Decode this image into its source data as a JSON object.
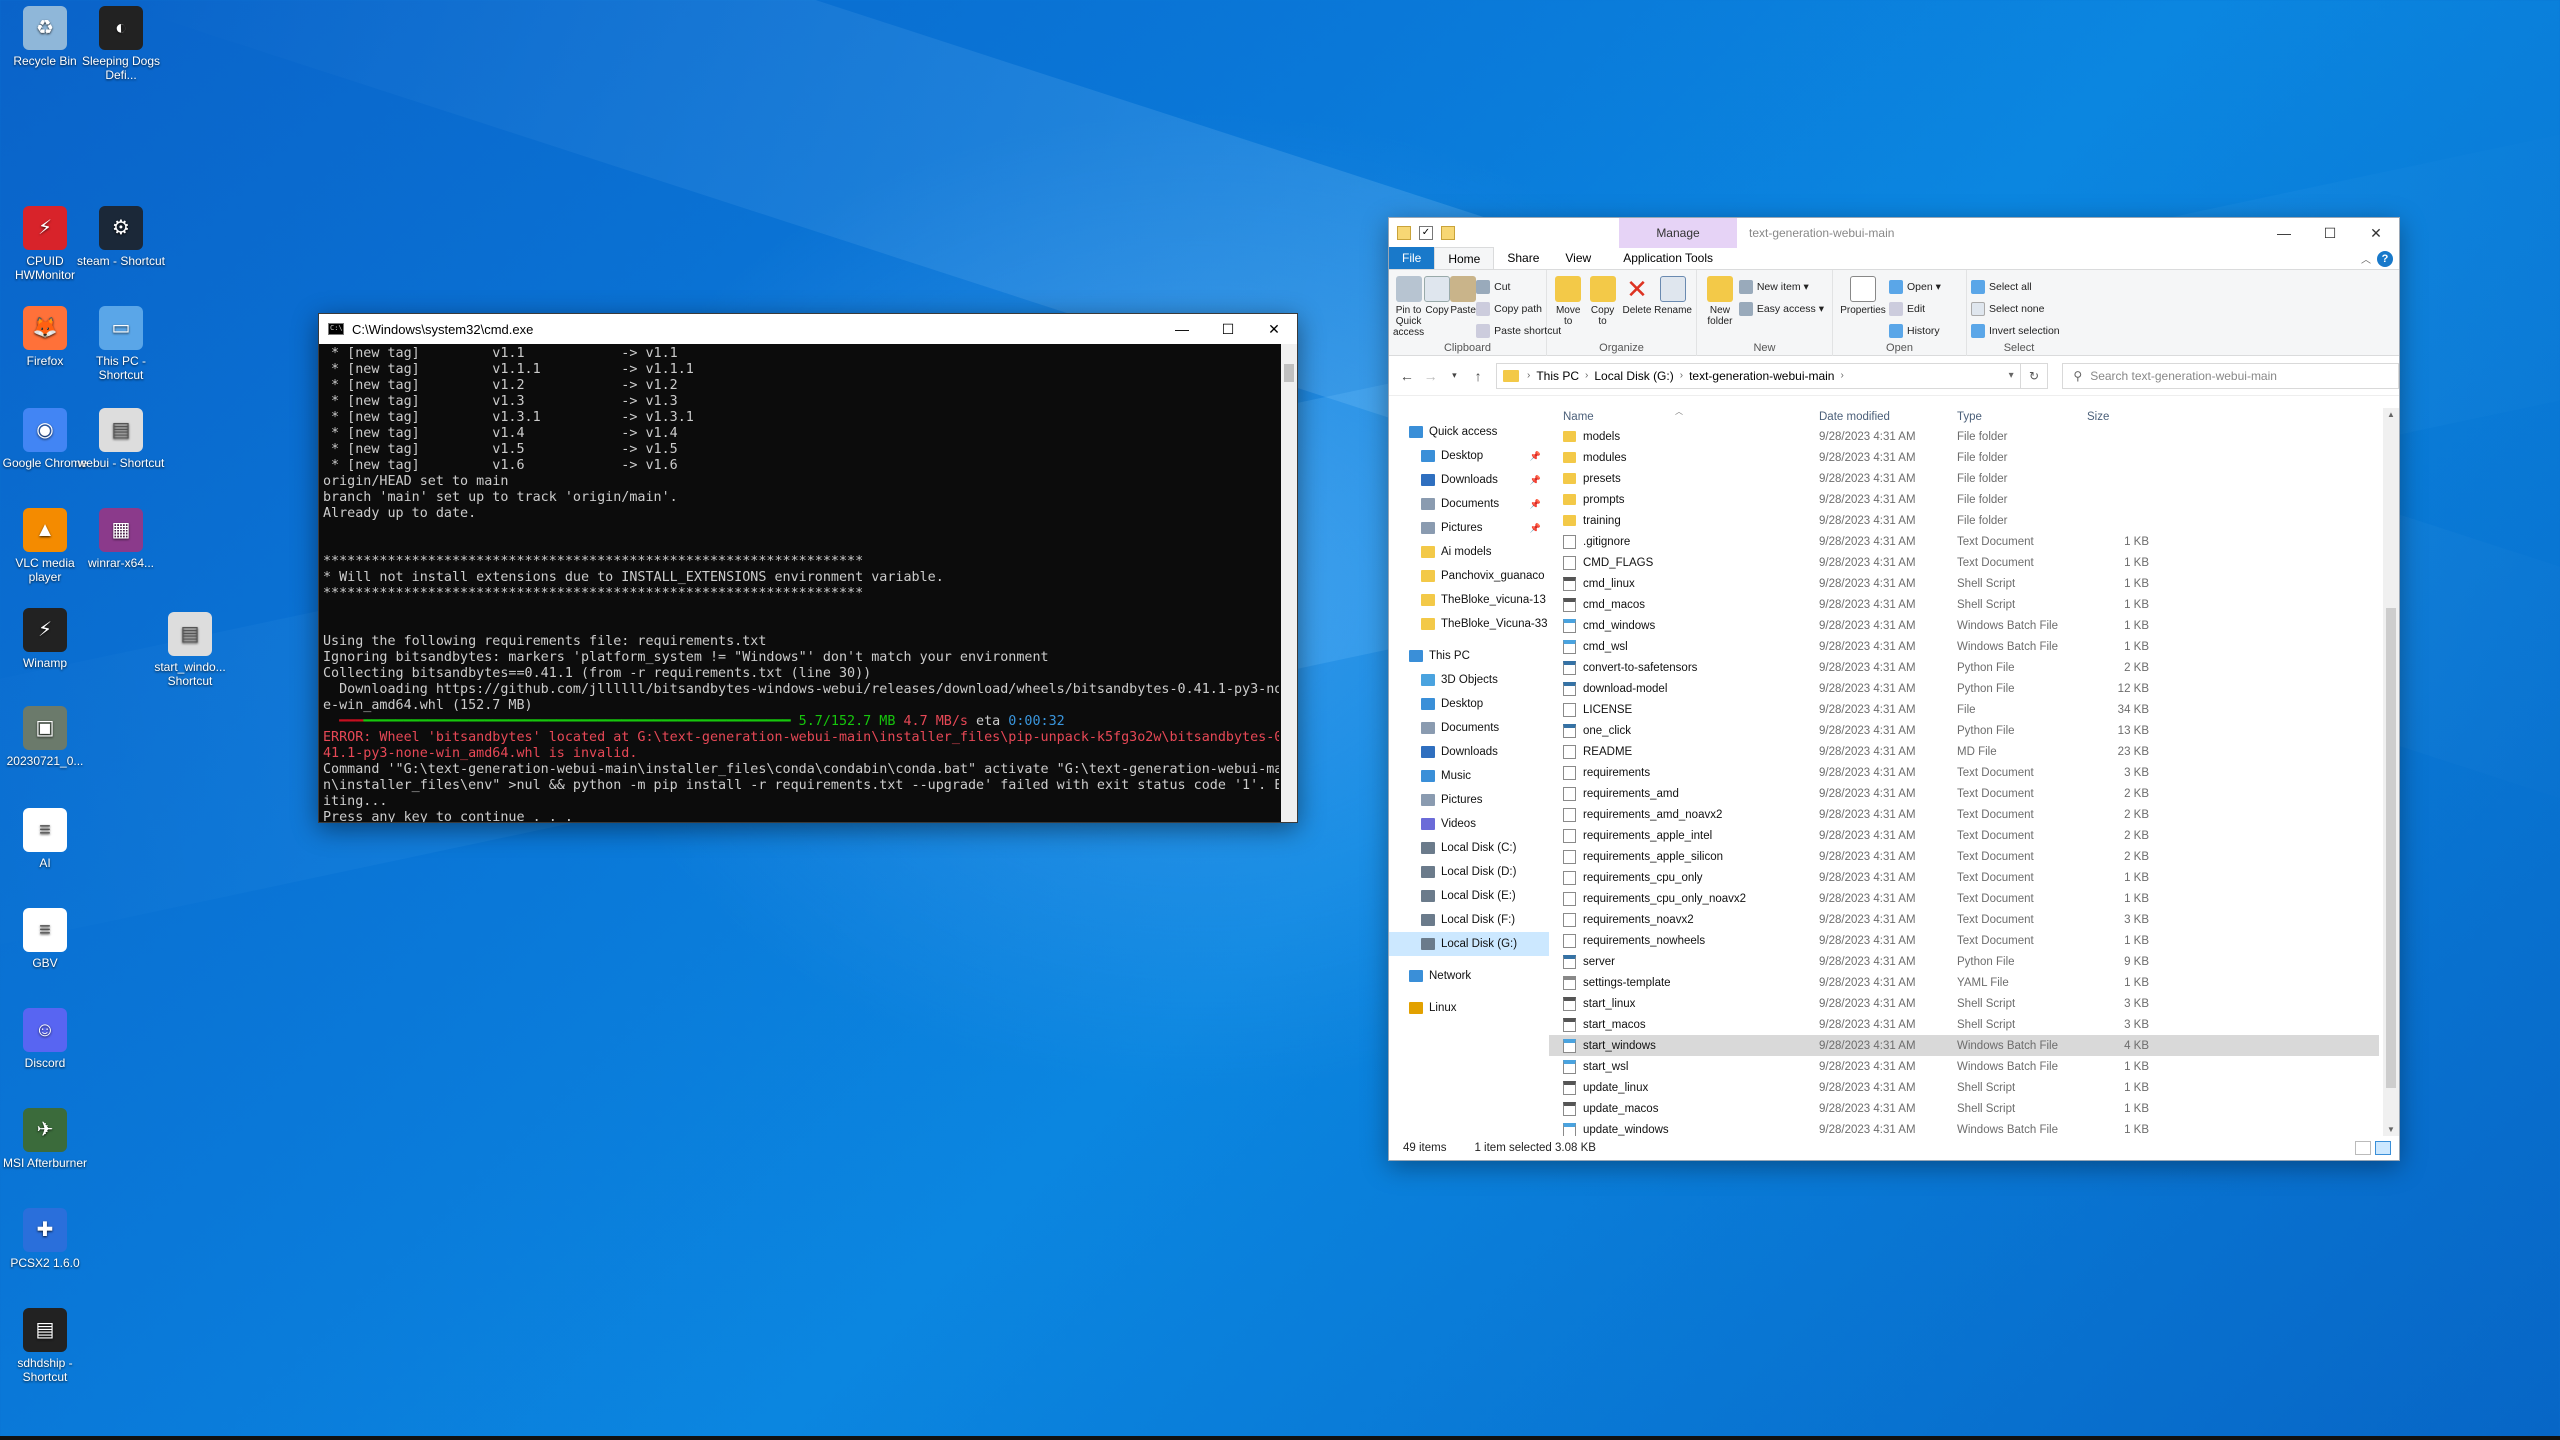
{
  "desktop": {
    "icons": [
      {
        "label": "Recycle Bin",
        "icon": "recycle-bin-icon",
        "color": "#8fb7d9",
        "glyph": "♻"
      },
      {
        "label": "Sleeping Dogs Defi...",
        "icon": "sleeping-dogs-icon",
        "color": "#222222",
        "glyph": "◐"
      },
      {
        "label": "CPUID HWMonitor",
        "icon": "hwmonitor-icon",
        "color": "#d8232a",
        "glyph": "⚡"
      },
      {
        "label": "steam - Shortcut",
        "icon": "steam-icon",
        "color": "#1b2838",
        "glyph": "⚙"
      },
      {
        "label": "Firefox",
        "icon": "firefox-icon",
        "color": "#ff7139",
        "glyph": "🦊"
      },
      {
        "label": "This PC - Shortcut",
        "icon": "this-pc-icon",
        "color": "#5aa6e8",
        "glyph": "▭"
      },
      {
        "label": "Google Chrome",
        "icon": "chrome-icon",
        "color": "#4285f4",
        "glyph": "◉"
      },
      {
        "label": "webui - Shortcut",
        "icon": "shortcut-icon",
        "color": "#dddddd",
        "glyph": "▤"
      },
      {
        "label": "VLC media player",
        "icon": "vlc-icon",
        "color": "#f48b00",
        "glyph": "▲"
      },
      {
        "label": "winrar-x64...",
        "icon": "winrar-icon",
        "color": "#8b3a8b",
        "glyph": "▦"
      },
      {
        "label": "Winamp",
        "icon": "winamp-icon",
        "color": "#222222",
        "glyph": "⚡"
      },
      {
        "label": "start_windo... Shortcut",
        "icon": "shortcut-icon",
        "color": "#dddddd",
        "glyph": "▤"
      },
      {
        "label": "20230721_0...",
        "icon": "image-file-icon",
        "color": "#6b7a6b",
        "glyph": "▣"
      },
      {
        "label": "AI",
        "icon": "text-file-icon",
        "color": "#ffffff",
        "glyph": "≡"
      },
      {
        "label": "GBV",
        "icon": "text-file-icon",
        "color": "#ffffff",
        "glyph": "≡"
      },
      {
        "label": "Discord",
        "icon": "discord-icon",
        "color": "#5865f2",
        "glyph": "☺"
      },
      {
        "label": "MSI Afterburner",
        "icon": "afterburner-icon",
        "color": "#3b6b3b",
        "glyph": "✈"
      },
      {
        "label": "PCSX2 1.6.0",
        "icon": "pcsx2-icon",
        "color": "#2a6fdb",
        "glyph": "✚"
      },
      {
        "label": "sdhdship - Shortcut",
        "icon": "sleeping-dogs-icon",
        "color": "#222222",
        "glyph": "▤"
      }
    ]
  },
  "cmd": {
    "title": "C:\\Windows\\system32\\cmd.exe",
    "lines": [
      " * [new tag]         v1.1            -> v1.1",
      " * [new tag]         v1.1.1          -> v1.1.1",
      " * [new tag]         v1.2            -> v1.2",
      " * [new tag]         v1.3            -> v1.3",
      " * [new tag]         v1.3.1          -> v1.3.1",
      " * [new tag]         v1.4            -> v1.4",
      " * [new tag]         v1.5            -> v1.5",
      " * [new tag]         v1.6            -> v1.6",
      "origin/HEAD set to main",
      "branch 'main' set up to track 'origin/main'.",
      "Already up to date.",
      "",
      "",
      "*******************************************************************",
      "* Will not install extensions due to INSTALL_EXTENSIONS environment variable.",
      "*******************************************************************",
      "",
      "",
      "Using the following requirements file: requirements.txt",
      "Ignoring bitsandbytes: markers 'platform_system != \"Windows\"' don't match your environment",
      "Collecting bitsandbytes==0.41.1 (from -r requirements.txt (line 30))",
      "  Downloading https://github.com/jllllll/bitsandbytes-windows-webui/releases/download/wheels/bitsandbytes-0.41.1-py3-non",
      "e-win_amd64.whl (152.7 MB)"
    ],
    "progress": {
      "done": "5.7/152.7 MB",
      "speed": "4.7 MB/s",
      "eta": "eta 0:00:32"
    },
    "error_lines": [
      "ERROR: Wheel 'bitsandbytes' located at G:\\text-generation-webui-main\\installer_files\\pip-unpack-k5fg3o2w\\bitsandbytes-0.",
      "41.1-py3-none-win_amd64.whl is invalid."
    ],
    "tail_lines": [
      "Command '\"G:\\text-generation-webui-main\\installer_files\\conda\\condabin\\conda.bat\" activate \"G:\\text-generation-webui-mai",
      "n\\installer_files\\env\" >nul && python -m pip install -r requirements.txt --upgrade' failed with exit status code '1'. Ex",
      "iting...",
      "Press any key to continue . . ."
    ]
  },
  "explorer": {
    "title": "text-generation-webui-main",
    "manage_tab": "Manage",
    "tabs": {
      "file": "File",
      "home": "Home",
      "share": "Share",
      "view": "View",
      "app_tools": "Application Tools"
    },
    "ribbon": {
      "clipboard": {
        "name": "Clipboard",
        "pin": "Pin to Quick access",
        "copy": "Copy",
        "paste": "Paste",
        "cut": "Cut",
        "copy_path": "Copy path",
        "paste_shortcut": "Paste shortcut"
      },
      "organize": {
        "name": "Organize",
        "move_to": "Move to",
        "copy_to": "Copy to",
        "delete": "Delete",
        "rename": "Rename"
      },
      "new": {
        "name": "New",
        "new_folder": "New folder",
        "new_item": "New item",
        "easy_access": "Easy access"
      },
      "open": {
        "name": "Open",
        "properties": "Properties",
        "open": "Open",
        "edit": "Edit",
        "history": "History"
      },
      "select": {
        "name": "Select",
        "select_all": "Select all",
        "select_none": "Select none",
        "invert": "Invert selection"
      }
    },
    "address": {
      "this_pc": "This PC",
      "disk": "Local Disk (G:)",
      "folder": "text-generation-webui-main"
    },
    "search_placeholder": "Search text-generation-webui-main",
    "columns": {
      "name": "Name",
      "date": "Date modified",
      "type": "Type",
      "size": "Size"
    },
    "nav": [
      {
        "label": "Quick access",
        "icon": "star-icon",
        "color": "#3a8fd8",
        "pin": false,
        "indent": 0
      },
      {
        "label": "Desktop",
        "icon": "desktop-icon",
        "color": "#3a8fd8",
        "pin": true,
        "indent": 1
      },
      {
        "label": "Downloads",
        "icon": "download-icon",
        "color": "#2f6fbf",
        "pin": true,
        "indent": 1
      },
      {
        "label": "Documents",
        "icon": "documents-icon",
        "color": "#8a9bb0",
        "pin": true,
        "indent": 1
      },
      {
        "label": "Pictures",
        "icon": "pictures-icon",
        "color": "#8a9bb0",
        "pin": true,
        "indent": 1
      },
      {
        "label": "Ai models",
        "icon": "folder-icon",
        "color": "#f3c948",
        "pin": false,
        "indent": 1
      },
      {
        "label": "Panchovix_guanaco",
        "icon": "folder-icon",
        "color": "#f3c948",
        "pin": false,
        "indent": 1
      },
      {
        "label": "TheBloke_vicuna-13",
        "icon": "folder-icon",
        "color": "#f3c948",
        "pin": false,
        "indent": 1
      },
      {
        "label": "TheBloke_Vicuna-33",
        "icon": "folder-icon",
        "color": "#f3c948",
        "pin": false,
        "indent": 1
      },
      {
        "label": "",
        "gap": true
      },
      {
        "label": "This PC",
        "icon": "this-pc-icon",
        "color": "#3a8fd8",
        "pin": false,
        "indent": 0
      },
      {
        "label": "3D Objects",
        "icon": "3d-objects-icon",
        "color": "#4aa3df",
        "pin": false,
        "indent": 1
      },
      {
        "label": "Desktop",
        "icon": "desktop-icon",
        "color": "#3a8fd8",
        "pin": false,
        "indent": 1
      },
      {
        "label": "Documents",
        "icon": "documents-icon",
        "color": "#8a9bb0",
        "pin": false,
        "indent": 1
      },
      {
        "label": "Downloads",
        "icon": "download-icon",
        "color": "#2f6fbf",
        "pin": false,
        "indent": 1
      },
      {
        "label": "Music",
        "icon": "music-icon",
        "color": "#3a8fd8",
        "pin": false,
        "indent": 1
      },
      {
        "label": "Pictures",
        "icon": "pictures-icon",
        "color": "#8a9bb0",
        "pin": false,
        "indent": 1
      },
      {
        "label": "Videos",
        "icon": "videos-icon",
        "color": "#6b6bd8",
        "pin": false,
        "indent": 1
      },
      {
        "label": "Local Disk (C:)",
        "icon": "drive-icon",
        "color": "#6b7b8b",
        "pin": false,
        "indent": 1
      },
      {
        "label": "Local Disk (D:)",
        "icon": "drive-icon",
        "color": "#6b7b8b",
        "pin": false,
        "indent": 1
      },
      {
        "label": "Local Disk (E:)",
        "icon": "drive-icon",
        "color": "#6b7b8b",
        "pin": false,
        "indent": 1
      },
      {
        "label": "Local Disk (F:)",
        "icon": "drive-icon",
        "color": "#6b7b8b",
        "pin": false,
        "indent": 1
      },
      {
        "label": "Local Disk (G:)",
        "icon": "drive-icon",
        "color": "#6b7b8b",
        "pin": false,
        "indent": 1,
        "selected": true
      },
      {
        "label": "",
        "gap": true
      },
      {
        "label": "Network",
        "icon": "network-icon",
        "color": "#3a8fd8",
        "pin": false,
        "indent": 0
      },
      {
        "label": "",
        "gap": true
      },
      {
        "label": "Linux",
        "icon": "linux-icon",
        "color": "#e2a100",
        "pin": false,
        "indent": 0
      }
    ],
    "files": [
      {
        "name": "models",
        "date": "9/28/2023 4:31 AM",
        "type": "File folder",
        "size": "",
        "kind": "folder"
      },
      {
        "name": "modules",
        "date": "9/28/2023 4:31 AM",
        "type": "File folder",
        "size": "",
        "kind": "folder"
      },
      {
        "name": "presets",
        "date": "9/28/2023 4:31 AM",
        "type": "File folder",
        "size": "",
        "kind": "folder"
      },
      {
        "name": "prompts",
        "date": "9/28/2023 4:31 AM",
        "type": "File folder",
        "size": "",
        "kind": "folder"
      },
      {
        "name": "training",
        "date": "9/28/2023 4:31 AM",
        "type": "File folder",
        "size": "",
        "kind": "folder"
      },
      {
        "name": ".gitignore",
        "date": "9/28/2023 4:31 AM",
        "type": "Text Document",
        "size": "1 KB",
        "kind": "doc"
      },
      {
        "name": "CMD_FLAGS",
        "date": "9/28/2023 4:31 AM",
        "type": "Text Document",
        "size": "1 KB",
        "kind": "doc"
      },
      {
        "name": "cmd_linux",
        "date": "9/28/2023 4:31 AM",
        "type": "Shell Script",
        "size": "1 KB",
        "kind": "sh"
      },
      {
        "name": "cmd_macos",
        "date": "9/28/2023 4:31 AM",
        "type": "Shell Script",
        "size": "1 KB",
        "kind": "sh"
      },
      {
        "name": "cmd_windows",
        "date": "9/28/2023 4:31 AM",
        "type": "Windows Batch File",
        "size": "1 KB",
        "kind": "bat"
      },
      {
        "name": "cmd_wsl",
        "date": "9/28/2023 4:31 AM",
        "type": "Windows Batch File",
        "size": "1 KB",
        "kind": "bat"
      },
      {
        "name": "convert-to-safetensors",
        "date": "9/28/2023 4:31 AM",
        "type": "Python File",
        "size": "2 KB",
        "kind": "py"
      },
      {
        "name": "download-model",
        "date": "9/28/2023 4:31 AM",
        "type": "Python File",
        "size": "12 KB",
        "kind": "py"
      },
      {
        "name": "LICENSE",
        "date": "9/28/2023 4:31 AM",
        "type": "File",
        "size": "34 KB",
        "kind": "doc"
      },
      {
        "name": "one_click",
        "date": "9/28/2023 4:31 AM",
        "type": "Python File",
        "size": "13 KB",
        "kind": "py"
      },
      {
        "name": "README",
        "date": "9/28/2023 4:31 AM",
        "type": "MD File",
        "size": "23 KB",
        "kind": "doc"
      },
      {
        "name": "requirements",
        "date": "9/28/2023 4:31 AM",
        "type": "Text Document",
        "size": "3 KB",
        "kind": "doc"
      },
      {
        "name": "requirements_amd",
        "date": "9/28/2023 4:31 AM",
        "type": "Text Document",
        "size": "2 KB",
        "kind": "doc"
      },
      {
        "name": "requirements_amd_noavx2",
        "date": "9/28/2023 4:31 AM",
        "type": "Text Document",
        "size": "2 KB",
        "kind": "doc"
      },
      {
        "name": "requirements_apple_intel",
        "date": "9/28/2023 4:31 AM",
        "type": "Text Document",
        "size": "2 KB",
        "kind": "doc"
      },
      {
        "name": "requirements_apple_silicon",
        "date": "9/28/2023 4:31 AM",
        "type": "Text Document",
        "size": "2 KB",
        "kind": "doc"
      },
      {
        "name": "requirements_cpu_only",
        "date": "9/28/2023 4:31 AM",
        "type": "Text Document",
        "size": "1 KB",
        "kind": "doc"
      },
      {
        "name": "requirements_cpu_only_noavx2",
        "date": "9/28/2023 4:31 AM",
        "type": "Text Document",
        "size": "1 KB",
        "kind": "doc"
      },
      {
        "name": "requirements_noavx2",
        "date": "9/28/2023 4:31 AM",
        "type": "Text Document",
        "size": "3 KB",
        "kind": "doc"
      },
      {
        "name": "requirements_nowheels",
        "date": "9/28/2023 4:31 AM",
        "type": "Text Document",
        "size": "1 KB",
        "kind": "doc"
      },
      {
        "name": "server",
        "date": "9/28/2023 4:31 AM",
        "type": "Python File",
        "size": "9 KB",
        "kind": "py"
      },
      {
        "name": "settings-template",
        "date": "9/28/2023 4:31 AM",
        "type": "YAML File",
        "size": "1 KB",
        "kind": "gear"
      },
      {
        "name": "start_linux",
        "date": "9/28/2023 4:31 AM",
        "type": "Shell Script",
        "size": "3 KB",
        "kind": "sh"
      },
      {
        "name": "start_macos",
        "date": "9/28/2023 4:31 AM",
        "type": "Shell Script",
        "size": "3 KB",
        "kind": "sh"
      },
      {
        "name": "start_windows",
        "date": "9/28/2023 4:31 AM",
        "type": "Windows Batch File",
        "size": "4 KB",
        "kind": "bat",
        "selected": true
      },
      {
        "name": "start_wsl",
        "date": "9/28/2023 4:31 AM",
        "type": "Windows Batch File",
        "size": "1 KB",
        "kind": "bat"
      },
      {
        "name": "update_linux",
        "date": "9/28/2023 4:31 AM",
        "type": "Shell Script",
        "size": "1 KB",
        "kind": "sh"
      },
      {
        "name": "update_macos",
        "date": "9/28/2023 4:31 AM",
        "type": "Shell Script",
        "size": "1 KB",
        "kind": "sh"
      },
      {
        "name": "update_windows",
        "date": "9/28/2023 4:31 AM",
        "type": "Windows Batch File",
        "size": "1 KB",
        "kind": "bat"
      }
    ],
    "status": {
      "items": "49 items",
      "selected": "1 item selected  3.08 KB"
    }
  }
}
